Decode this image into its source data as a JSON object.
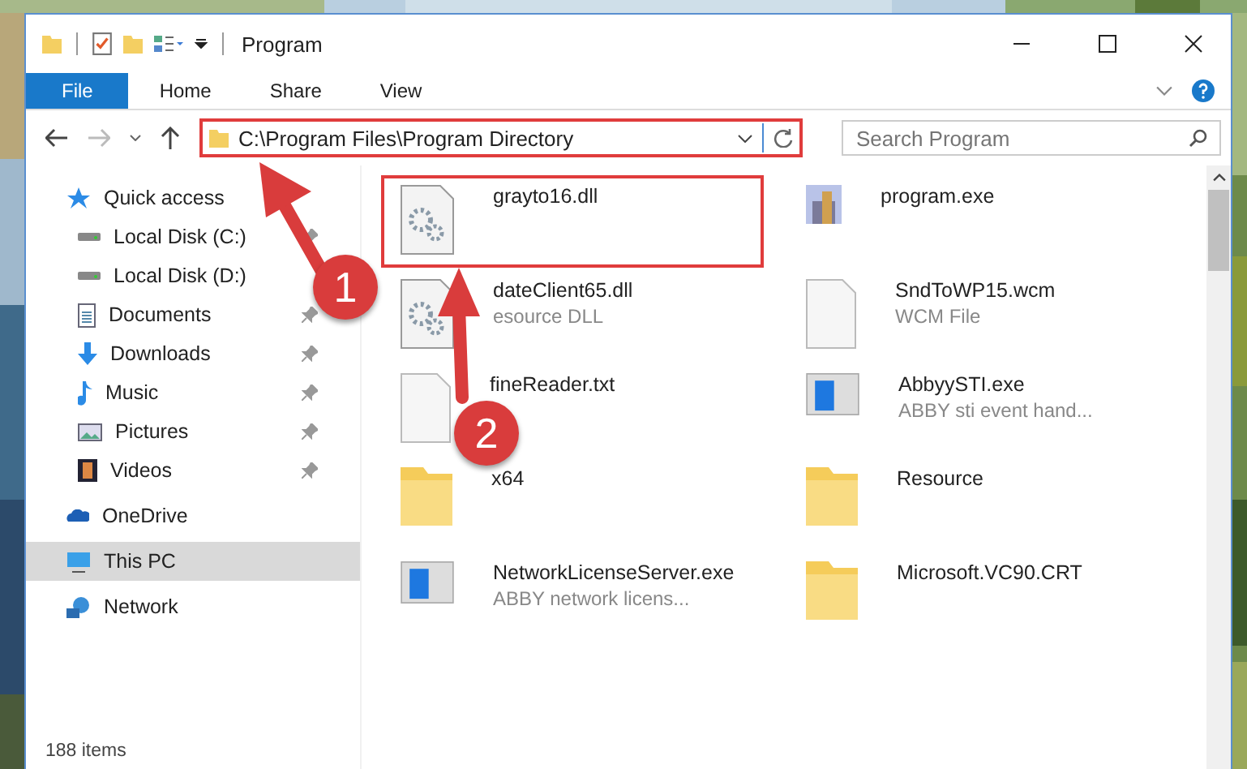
{
  "window": {
    "title": "Program"
  },
  "ribbon_tabs": [
    {
      "label": "File",
      "selected": true
    },
    {
      "label": "Home",
      "selected": false
    },
    {
      "label": "Share",
      "selected": false
    },
    {
      "label": "View",
      "selected": false
    }
  ],
  "address": {
    "path": "C:\\Program Files\\Program Directory"
  },
  "search": {
    "placeholder": "Search Program"
  },
  "sidebar": {
    "items": [
      {
        "label": "Quick access",
        "kind": "star",
        "selected": false,
        "children": [
          {
            "label": "Local Disk (C:)",
            "kind": "drive",
            "pinned": true,
            "selected": false
          },
          {
            "label": "Local Disk (D:)",
            "kind": "drive",
            "selected": false
          },
          {
            "label": "Documents",
            "kind": "doc",
            "pinned": true,
            "selected": false
          },
          {
            "label": "Downloads",
            "kind": "download",
            "pinned": true,
            "selected": false
          },
          {
            "label": "Music",
            "kind": "music",
            "pinned": true,
            "selected": false
          },
          {
            "label": "Pictures",
            "kind": "pictures",
            "pinned": true,
            "selected": false
          },
          {
            "label": "Videos",
            "kind": "videos",
            "pinned": true,
            "selected": false
          }
        ]
      },
      {
        "label": "OneDrive",
        "kind": "cloud",
        "selected": false
      },
      {
        "label": "This PC",
        "kind": "pc",
        "selected": true
      },
      {
        "label": "Network",
        "kind": "network",
        "selected": false
      }
    ]
  },
  "files": [
    {
      "name": "grayto16.dll",
      "kind": "dll",
      "highlighted": true
    },
    {
      "name": "program.exe",
      "kind": "exe",
      "highlighted": false
    },
    {
      "name": "dateClient65.dll",
      "description": "esource DLL",
      "kind": "dll",
      "highlighted": false
    },
    {
      "name": "SndToWP15.wcm",
      "description": "WCM File",
      "kind": "file",
      "highlighted": false
    },
    {
      "name": "fineReader.txt",
      "kind": "file",
      "highlighted": false
    },
    {
      "name": "AbbyySTI.exe",
      "description": "ABBY sti event hand...",
      "kind": "app",
      "highlighted": false
    },
    {
      "name": "x64",
      "kind": "folder",
      "highlighted": false
    },
    {
      "name": "Resource",
      "kind": "folder",
      "highlighted": false
    },
    {
      "name": "NetworkLicenseServer.exe",
      "description": "ABBY network licens...",
      "kind": "app",
      "highlighted": false
    },
    {
      "name": "Microsoft.VC90.CRT",
      "kind": "folder",
      "highlighted": false
    }
  ],
  "status_bar": {
    "count": "188 items"
  },
  "callouts": [
    {
      "label": "1"
    },
    {
      "label": "2"
    }
  ]
}
